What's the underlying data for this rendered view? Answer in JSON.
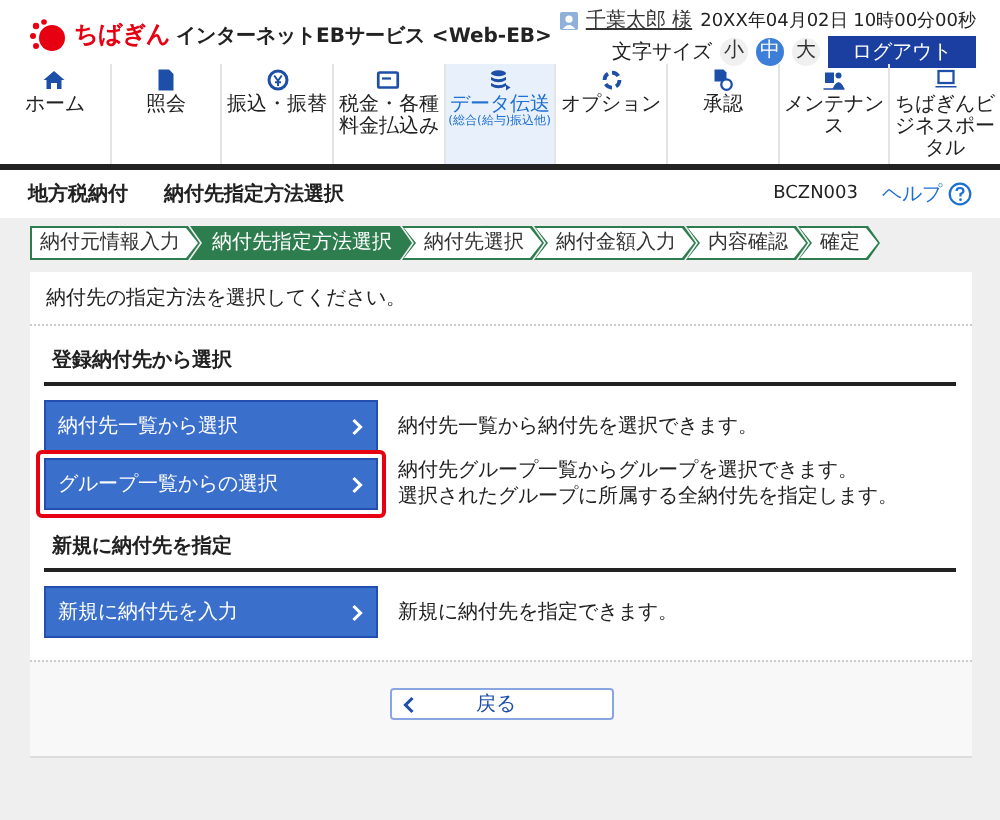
{
  "header": {
    "logo": "ちばぎん",
    "service": "インターネットEBサービス <Web-EB>",
    "user": "千葉太郎 様",
    "datetime": "20XX年04月02日 10時00分00秒",
    "font_size_label": "文字サイズ",
    "font_sizes": [
      {
        "label": "小",
        "selected": false
      },
      {
        "label": "中",
        "selected": true
      },
      {
        "label": "大",
        "selected": false
      }
    ],
    "logout": "ログアウト"
  },
  "nav": [
    {
      "label": "ホーム",
      "selected": false
    },
    {
      "label": "照会",
      "selected": false
    },
    {
      "label": "振込・振替",
      "selected": false
    },
    {
      "label": "税金・各種料金払込み",
      "selected": false
    },
    {
      "label": "データ伝送",
      "sublabel": "(総合(給与)振込他)",
      "selected": true
    },
    {
      "label": "オプション",
      "selected": false
    },
    {
      "label": "承認",
      "selected": false
    },
    {
      "label": "メンテナンス",
      "selected": false
    },
    {
      "label": "ちばぎんビジネスポータル",
      "selected": false
    }
  ],
  "page": {
    "category": "地方税納付",
    "title": "納付先指定方法選択",
    "screen_id": "BCZN003",
    "help": "ヘルプ"
  },
  "steps": [
    {
      "label": "納付元情報入力",
      "selected": false
    },
    {
      "label": "納付先指定方法選択",
      "selected": true
    },
    {
      "label": "納付先選択",
      "selected": false
    },
    {
      "label": "納付金額入力",
      "selected": false
    },
    {
      "label": "内容確認",
      "selected": false
    },
    {
      "label": "確定",
      "selected": false
    }
  ],
  "instruction": "納付先の指定方法を選択してください。",
  "sections": [
    {
      "heading": "登録納付先から選択",
      "options": [
        {
          "label": "納付先一覧から選択",
          "description": [
            "納付先一覧から納付先を選択できます。"
          ],
          "highlighted": false
        },
        {
          "label": "グループ一覧からの選択",
          "description": [
            "納付先グループ一覧からグループを選択できます。",
            "選択されたグループに所属する全納付先を指定します。"
          ],
          "highlighted": true
        }
      ]
    },
    {
      "heading": "新規に納付先を指定",
      "options": [
        {
          "label": "新規に納付先を入力",
          "description": [
            "新規に納付先を指定できます。"
          ],
          "highlighted": false
        }
      ]
    }
  ],
  "back_button": "戻る"
}
